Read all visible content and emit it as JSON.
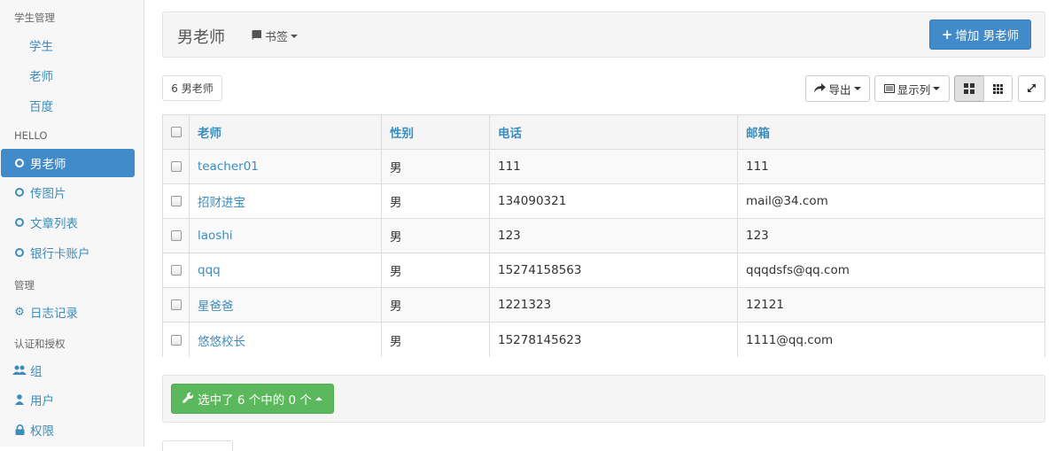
{
  "sidebar": {
    "section_students": "学生管理",
    "students_items": [
      "学生",
      "老师",
      "百度"
    ],
    "section_hello": "HELLO",
    "hello_items": [
      "男老师",
      "传图片",
      "文章列表",
      "银行卡账户"
    ],
    "section_manage": "管理",
    "log_item": "日志记录",
    "section_auth": "认证和授权",
    "auth_items": [
      "组",
      "用户",
      "权限"
    ]
  },
  "header": {
    "title": "男老师",
    "bookmark_label": "书签",
    "add_button_label": "增加 男老师"
  },
  "toolbar": {
    "count_label": "6 男老师",
    "export_label": "导出",
    "columns_label": "显示列"
  },
  "table": {
    "columns": [
      "老师",
      "性别",
      "电话",
      "邮箱"
    ],
    "rows": [
      {
        "name": "teacher01",
        "gender": "男",
        "phone": "111",
        "email": "111"
      },
      {
        "name": "招财进宝",
        "gender": "男",
        "phone": "134090321",
        "email": "mail@34.com"
      },
      {
        "name": "laoshi",
        "gender": "男",
        "phone": "123",
        "email": "123"
      },
      {
        "name": "qqq",
        "gender": "男",
        "phone": "15274158563",
        "email": "qqqdsfs@qq.com"
      },
      {
        "name": "星爸爸",
        "gender": "男",
        "phone": "1221323",
        "email": "12121"
      },
      {
        "name": "悠悠校长",
        "gender": "男",
        "phone": "15278145623",
        "email": "1111@qq.com"
      }
    ]
  },
  "footer": {
    "selection_label": "选中了 6 个中的 0 个"
  },
  "colors": {
    "primary": "#428bca",
    "link": "#3c8dbc",
    "success": "#5cb85c"
  }
}
